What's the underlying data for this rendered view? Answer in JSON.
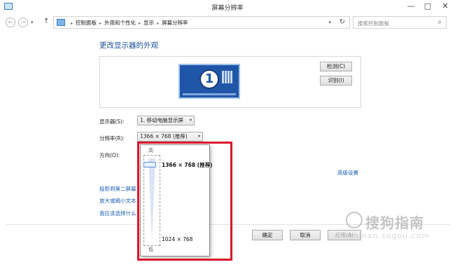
{
  "window": {
    "title": "屏幕分辨率",
    "min_glyph": "—",
    "max_glyph": "□",
    "close_glyph": "✕"
  },
  "nav": {
    "back_glyph": "←",
    "forward_glyph": "→",
    "dropdown_glyph": "▾",
    "up_glyph": "↑",
    "breadcrumbs": [
      "控制面板",
      "外观和个性化",
      "显示",
      "屏幕分辨率"
    ],
    "sep_glyph": "▸",
    "refresh_glyph": "↻",
    "search_placeholder": "搜索控制面板",
    "search_glyph": "⌕"
  },
  "main": {
    "heading": "更改显示器的外观",
    "monitor_number": "1",
    "detect_button": "检测(C)",
    "identify_button": "识别(I)",
    "display_label": "显示器(S):",
    "display_value": "1. 移动电脑显示屏",
    "resolution_label": "分辨率(R):",
    "resolution_value": "1366 × 768 (推荐)",
    "orientation_label": "方向(O):",
    "select_arrow": "▾",
    "advanced_link": "高级设置",
    "links": [
      "投影到第二屏幕",
      "放大或缩小文本",
      "我应该选择什么"
    ]
  },
  "footer": {
    "ok": "确定",
    "cancel": "取消",
    "apply": "应用(A)"
  },
  "resolution_popup": {
    "high_label": "高",
    "low_label": "低",
    "top_value": "1366 × 768 (推荐)",
    "bottom_value": "1024 × 768",
    "slider_position": 1.0
  },
  "watermark": {
    "text": "搜狗指南",
    "sub": "zhinan.sogou.com"
  },
  "colors": {
    "link": "#1a5fb4",
    "heading": "#1e4e9a",
    "highlight_box": "#d8152b",
    "monitor": "#1f56a8"
  }
}
